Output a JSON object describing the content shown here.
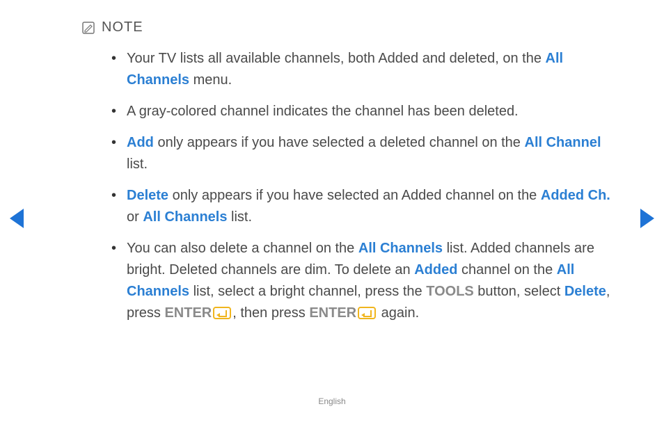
{
  "note_label": "NOTE",
  "bullets": {
    "b1": {
      "t1": "Your TV lists all available channels, both Added and deleted, on the ",
      "k1": "All Channels",
      "t2": " menu."
    },
    "b2": {
      "t1": "A gray-colored channel indicates the channel has been deleted."
    },
    "b3": {
      "k1": "Add",
      "t1": " only appears if you have selected a deleted channel on the ",
      "k2": "All Channel",
      "t2": " list."
    },
    "b4": {
      "k1": "Delete",
      "t1": " only appears if you have selected an Added channel on the ",
      "k2": "Added Ch.",
      "t2": " or ",
      "k3": "All Channels",
      "t3": " list."
    },
    "b5": {
      "t1": "You can also delete a channel on the ",
      "k1": "All Channels",
      "t2": " list. Added channels are bright. Deleted channels are dim. To delete an ",
      "k2": "Added",
      "t3": " channel on the ",
      "k3": "All Channels",
      "t4": " list, select a bright channel, press the ",
      "g1": "TOOLS",
      "t5": " button, select ",
      "k4": "Delete",
      "t6": ", press ",
      "g2": "ENTER",
      "t7": ", then press ",
      "g3": "ENTER",
      "t8": " again."
    }
  },
  "footer": "English"
}
